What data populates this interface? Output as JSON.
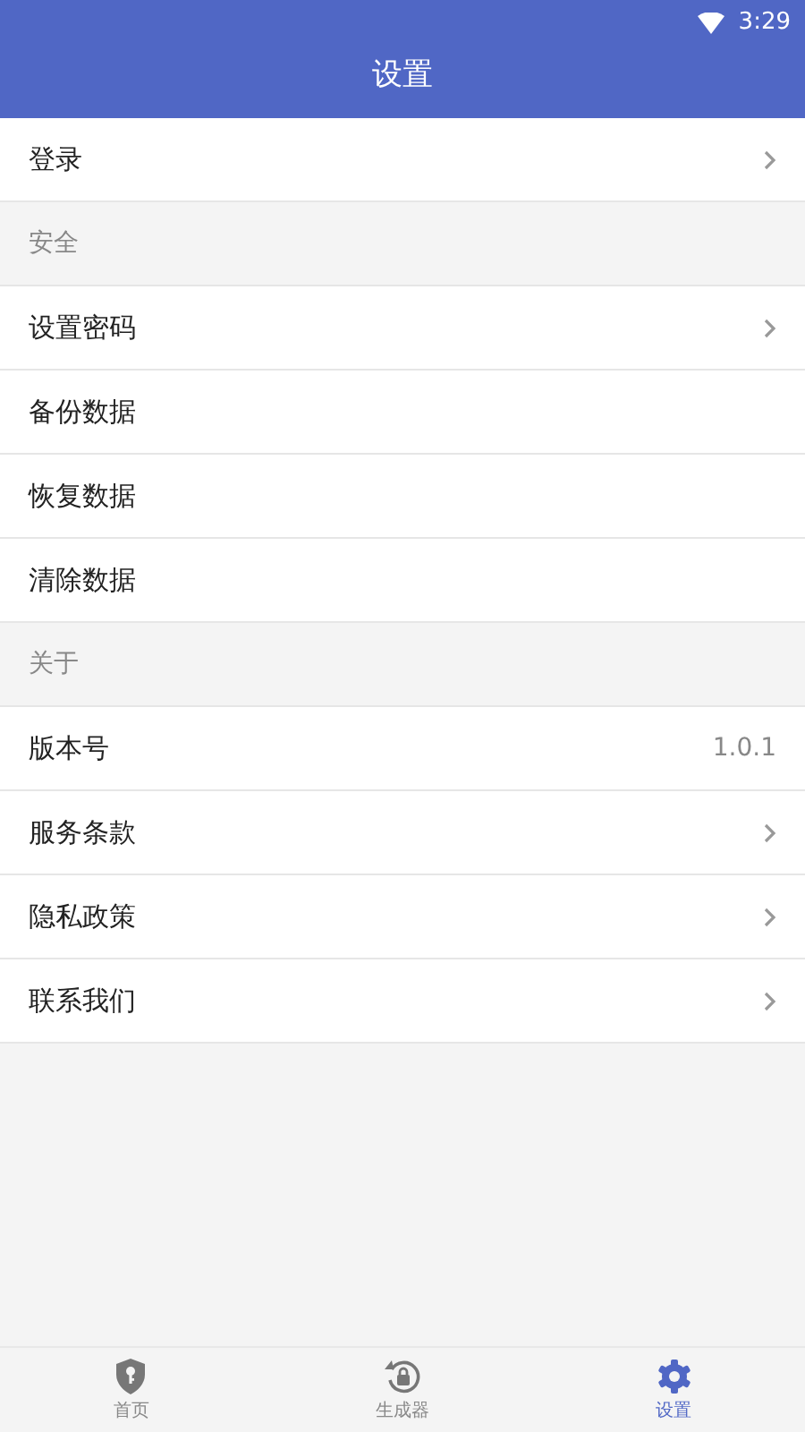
{
  "status_bar": {
    "time": "3:29"
  },
  "title": "设置",
  "rows": [
    {
      "kind": "item",
      "label": "登录",
      "chevron": true
    },
    {
      "kind": "header",
      "label": "安全"
    },
    {
      "kind": "item",
      "label": "设置密码",
      "chevron": true
    },
    {
      "kind": "item",
      "label": "备份数据",
      "chevron": false
    },
    {
      "kind": "item",
      "label": "恢复数据",
      "chevron": false
    },
    {
      "kind": "item",
      "label": "清除数据",
      "chevron": false
    },
    {
      "kind": "header",
      "label": "关于"
    },
    {
      "kind": "item",
      "label": "版本号",
      "chevron": false,
      "value": "1.0.1"
    },
    {
      "kind": "item",
      "label": "服务条款",
      "chevron": true
    },
    {
      "kind": "item",
      "label": "隐私政策",
      "chevron": true
    },
    {
      "kind": "item",
      "label": "联系我们",
      "chevron": true
    }
  ],
  "tabs": [
    {
      "kind": "shield",
      "label": "首页",
      "selected": false
    },
    {
      "kind": "lock",
      "label": "生成器",
      "selected": false
    },
    {
      "kind": "gear",
      "label": "设置",
      "selected": true
    }
  ]
}
